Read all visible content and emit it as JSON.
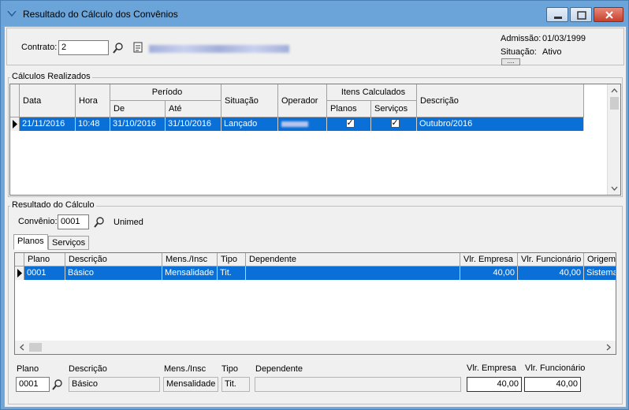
{
  "window": {
    "title": "Resultado do Cálculo dos Convênios",
    "minimize_label": "—",
    "maximize_label": "□",
    "close_label": "✕"
  },
  "header": {
    "contract_label": "Contrato:",
    "contract_value": "2",
    "admission_label": "Admissão:",
    "admission_value": "01/03/1999",
    "status_label": "Situação:",
    "status_value": "Ativo",
    "more_button": "...."
  },
  "calcs": {
    "group_title": "Cálculos Realizados",
    "columns": {
      "data": "Data",
      "hora": "Hora",
      "periodo": "Período",
      "de": "De",
      "ate": "Até",
      "situacao": "Situação",
      "operador": "Operador",
      "itens": "Itens Calculados",
      "planos": "Planos",
      "servicos": "Serviços",
      "descricao": "Descrição"
    },
    "rows": [
      {
        "data": "21/11/2016",
        "hora": "10:48",
        "de": "31/10/2016",
        "ate": "31/10/2016",
        "situacao": "Lançado",
        "planos": true,
        "servicos": true,
        "descricao": "Outubro/2016"
      }
    ]
  },
  "result": {
    "group_title": "Resultado do Cálculo",
    "convenio_label": "Convênio:",
    "convenio_code": "0001",
    "convenio_name": "Unimed",
    "tabs": [
      "Planos",
      "Serviços"
    ],
    "columns": {
      "plano": "Plano",
      "descricao": "Descrição",
      "mens": "Mens./Insc",
      "tipo": "Tipo",
      "dependente": "Dependente",
      "vlr_empresa": "Vlr. Empresa",
      "vlr_funcionario": "Vlr. Funcionário",
      "origem": "Origem"
    },
    "rows": [
      {
        "plano": "0001",
        "descricao": "Básico",
        "mens": "Mensalidade",
        "tipo": "Tit.",
        "dependente": "",
        "vlr_empresa": "40,00",
        "vlr_funcionario": "40,00",
        "origem": "Sistema"
      }
    ]
  },
  "detail": {
    "plano_label": "Plano",
    "descricao_label": "Descrição",
    "mens_label": "Mens./Insc",
    "tipo_label": "Tipo",
    "dependente_label": "Dependente",
    "vlr_empresa_label": "Vlr. Empresa",
    "vlr_funcionario_label": "Vlr. Funcionário",
    "plano_value": "0001",
    "descricao_value": "Básico",
    "mens_value": "Mensalidade",
    "tipo_value": "Tit.",
    "dependente_value": "",
    "vlr_empresa_value": "40,00",
    "vlr_funcionario_value": "40,00"
  }
}
